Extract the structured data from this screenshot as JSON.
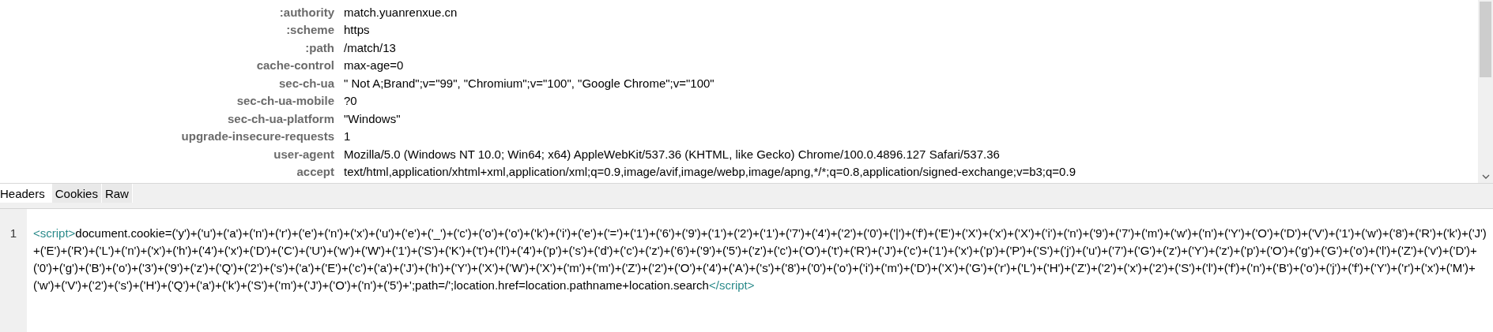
{
  "headers": [
    {
      "name": ":authority",
      "value": "match.yuanrenxue.cn"
    },
    {
      "name": ":scheme",
      "value": "https"
    },
    {
      "name": ":path",
      "value": "/match/13"
    },
    {
      "name": "cache-control",
      "value": "max-age=0"
    },
    {
      "name": "sec-ch-ua",
      "value": "\" Not A;Brand\";v=\"99\", \"Chromium\";v=\"100\", \"Google Chrome\";v=\"100\""
    },
    {
      "name": "sec-ch-ua-mobile",
      "value": "?0"
    },
    {
      "name": "sec-ch-ua-platform",
      "value": "\"Windows\""
    },
    {
      "name": "upgrade-insecure-requests",
      "value": "1"
    },
    {
      "name": "user-agent",
      "value": "Mozilla/5.0 (Windows NT 10.0; Win64; x64) AppleWebKit/537.36 (KHTML, like Gecko) Chrome/100.0.4896.127 Safari/537.36"
    },
    {
      "name": "accept",
      "value": "text/html,application/xhtml+xml,application/xml;q=0.9,image/avif,image/webp,image/apng,*/*;q=0.8,application/signed-exchange;v=b3;q=0.9"
    }
  ],
  "tabs": [
    {
      "label": "Headers",
      "selected": true
    },
    {
      "label": "Cookies",
      "selected": false
    },
    {
      "label": "Raw",
      "selected": false
    }
  ],
  "code": {
    "line_number": "1",
    "tag_open": "<script>",
    "text": "document.cookie=('y')+('u')+('a')+('n')+('r')+('e')+('n')+('x')+('u')+('e')+('_')+('c')+('o')+('o')+('k')+('i')+('e')+('=')+('1')+('6')+('9')+('1')+('2')+('1')+('7')+('4')+('2')+('0')+('|')+('f')+('E')+('X')+('x')+('X')+('i')+('n')+('9')+('7')+('m')+('w')+('n')+('Y')+('O')+('D')+('V')+('1')+('w')+('8')+('R')+('k')+('J')+('E')+('R')+('L')+('n')+('x')+('h')+('4')+('x')+('D')+('C')+('U')+('w')+('W')+('1')+('S')+('K')+('t')+('l')+('4')+('p')+('s')+('d')+('c')+('z')+('6')+('9')+('5')+('z')+('c')+('O')+('t')+('R')+('J')+('c')+('1')+('x')+('p')+('P')+('S')+('j')+('u')+('7')+('G')+('z')+('Y')+('z')+('p')+('O')+('g')+('G')+('o')+('l')+('Z')+('v')+('D')+('0')+('g')+('B')+('o')+('3')+('9')+('z')+('Q')+('2')+('s')+('a')+('E')+('c')+('a')+('J')+('h')+('Y')+('X')+('W')+('X')+('m')+('m')+('Z')+('2')+('O')+('4')+('A')+('s')+('8')+('0')+('o')+('i')+('m')+('D')+('X')+('G')+('r')+('L')+('H')+('Z')+('2')+('x')+('2')+('S')+('l')+('f')+('n')+('B')+('o')+('j')+('f')+('Y')+('r')+('x')+('M')+('w')+('V')+('2')+('s')+('H')+('Q')+('a')+('k')+('S')+('m')+('J')+('O')+('n')+('5')+';path=/';location.href=location.pathname+location.search",
    "tag_close": "</script>"
  }
}
